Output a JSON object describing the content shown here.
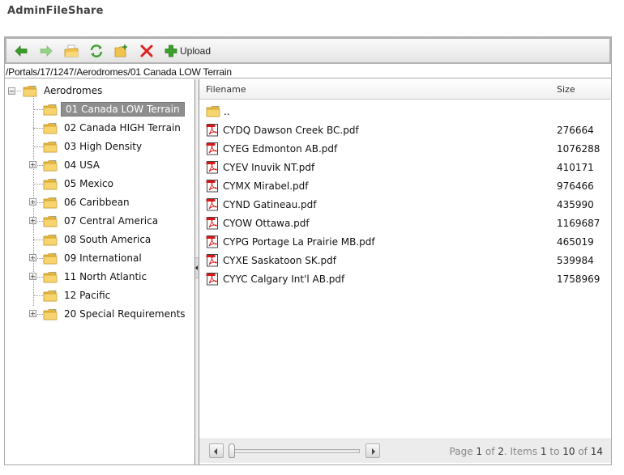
{
  "app": {
    "title": "AdminFileShare"
  },
  "toolbar": {
    "buttons": [
      {
        "name": "back",
        "icon": "arrow-left-icon"
      },
      {
        "name": "forward",
        "icon": "arrow-right-icon"
      },
      {
        "name": "open",
        "icon": "open-folder-icon"
      },
      {
        "name": "refresh",
        "icon": "refresh-icon"
      },
      {
        "name": "new-folder",
        "icon": "new-folder-icon"
      },
      {
        "name": "delete",
        "icon": "delete-icon"
      }
    ],
    "upload_label": "Upload"
  },
  "address": {
    "path": "/Portals/17/1247/Aerodromes/01 Canada LOW Terrain"
  },
  "tree": {
    "root": {
      "label": "Aerodromes",
      "expanded": true
    },
    "children": [
      {
        "label": "01 Canada LOW Terrain",
        "expandable": false,
        "selected": true
      },
      {
        "label": "02 Canada HIGH Terrain",
        "expandable": false
      },
      {
        "label": "03 High Density",
        "expandable": false
      },
      {
        "label": "04 USA",
        "expandable": true
      },
      {
        "label": "05 Mexico",
        "expandable": false
      },
      {
        "label": "06 Caribbean",
        "expandable": true
      },
      {
        "label": "07 Central America",
        "expandable": true
      },
      {
        "label": "08 South America",
        "expandable": false
      },
      {
        "label": "09 International",
        "expandable": true
      },
      {
        "label": "11 North Atlantic",
        "expandable": true
      },
      {
        "label": "12 Pacific",
        "expandable": false
      },
      {
        "label": "20 Special Requirements",
        "expandable": true
      }
    ]
  },
  "grid": {
    "columns": {
      "filename": "Filename",
      "size": "Size"
    },
    "parent_row": {
      "name": ".."
    },
    "rows": [
      {
        "name": "CYDQ Dawson Creek BC.pdf",
        "size": "276664"
      },
      {
        "name": "CYEG Edmonton AB.pdf",
        "size": "1076288"
      },
      {
        "name": "CYEV Inuvik NT.pdf",
        "size": "410171"
      },
      {
        "name": "CYMX Mirabel.pdf",
        "size": "976466"
      },
      {
        "name": "CYND Gatineau.pdf",
        "size": "435990"
      },
      {
        "name": "CYOW Ottawa.pdf",
        "size": "1169687"
      },
      {
        "name": "CYPG Portage La Prairie MB.pdf",
        "size": "465019"
      },
      {
        "name": "CYXE Saskatoon SK.pdf",
        "size": "539984"
      },
      {
        "name": "CYYC Calgary Int'l AB.pdf",
        "size": "1758969"
      }
    ]
  },
  "pager": {
    "page_word": "Page ",
    "current_page": "1",
    "of_word": " of ",
    "total_pages": "2",
    "items_word": ". Items ",
    "item_from": "1",
    "to_word": " to ",
    "item_to": "10",
    "of_word2": " of ",
    "total_items": "14",
    "slider_fraction": 0
  }
}
